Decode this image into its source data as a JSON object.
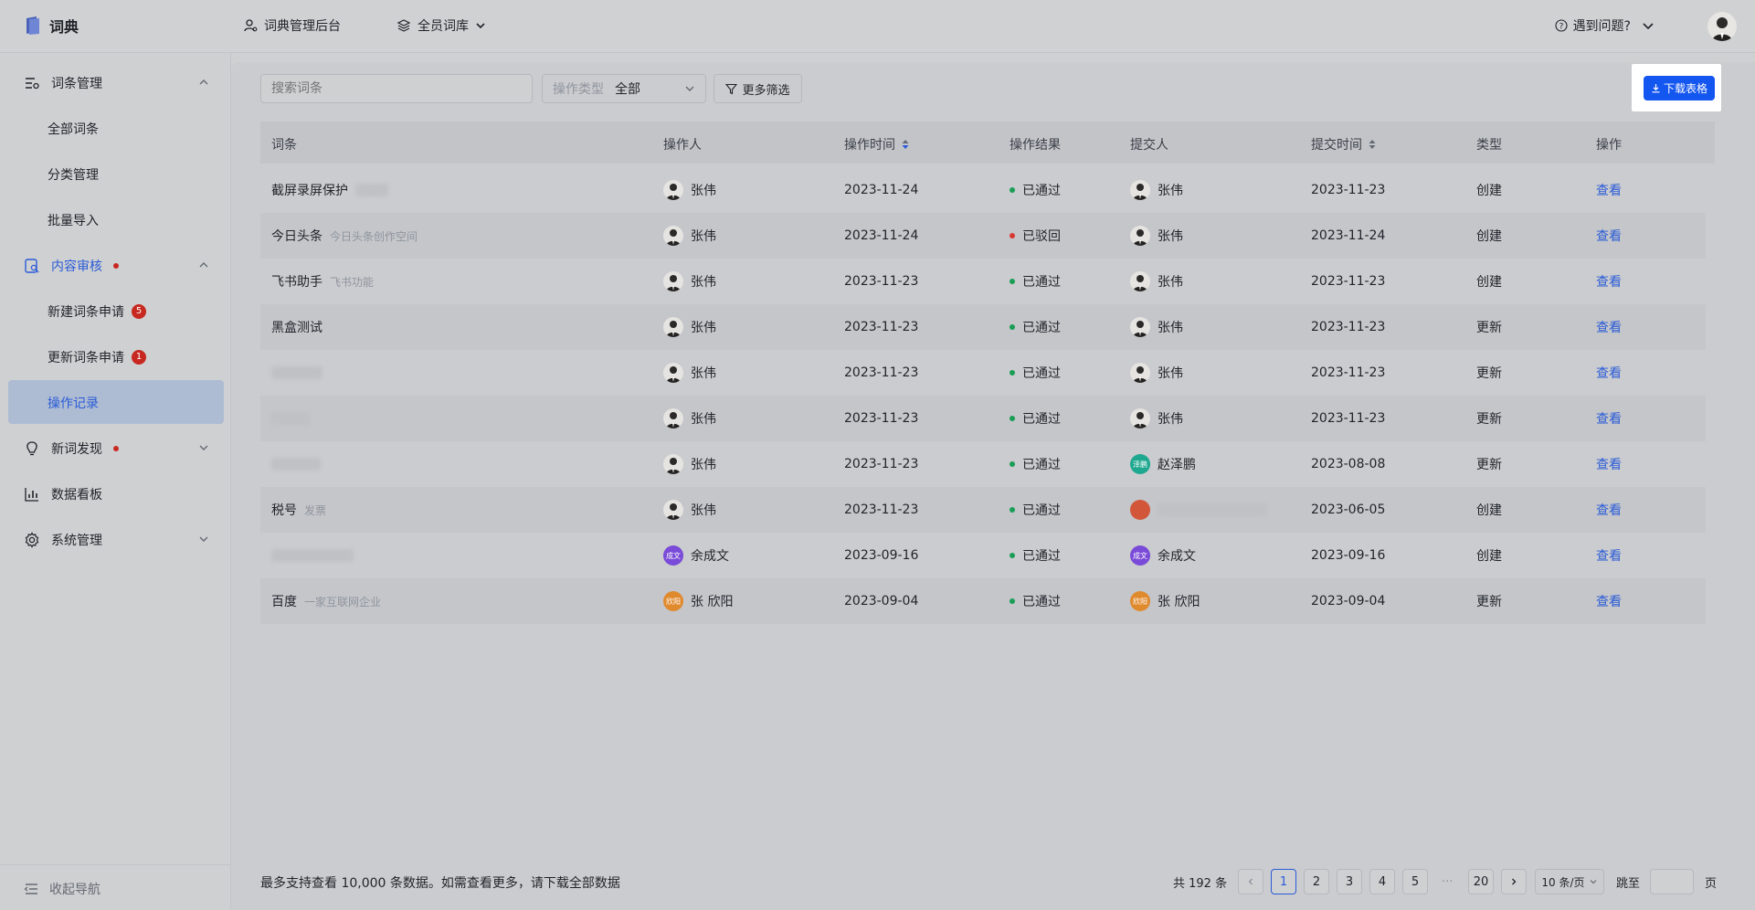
{
  "header": {
    "app_title": "词典",
    "admin_label": "词典管理后台",
    "library_label": "全员词库",
    "help_label": "遇到问题?"
  },
  "sidebar": {
    "groups": [
      {
        "label": "词条管理",
        "icon": "list-settings-icon"
      },
      {
        "label": "内容审核",
        "icon": "review-doc-icon"
      },
      {
        "label": "新词发现",
        "icon": "lightbulb-icon"
      },
      {
        "label": "数据看板",
        "icon": "bar-chart-icon"
      },
      {
        "label": "系统管理",
        "icon": "gear-icon"
      }
    ],
    "entry_items": [
      "全部词条",
      "分类管理",
      "批量导入"
    ],
    "review_items": [
      {
        "label": "新建词条申请",
        "badge": "5"
      },
      {
        "label": "更新词条申请",
        "badge": "1"
      },
      {
        "label": "操作记录"
      }
    ],
    "collapse_label": "收起导航"
  },
  "toolbar": {
    "search_placeholder": "搜索词条",
    "op_type_label": "操作类型",
    "op_type_value": "全部",
    "more_filter_label": "更多筛选",
    "download_label": "下载表格"
  },
  "table": {
    "columns": [
      "词条",
      "操作人",
      "操作时间",
      "操作结果",
      "提交人",
      "提交时间",
      "类型",
      "操作"
    ],
    "rows": [
      {
        "term": "截屏录屏保护",
        "desc": "",
        "operator": "张伟",
        "op_time": "2023-11-24",
        "result": "已通过",
        "submitter": "张伟",
        "submit_time": "2023-11-23",
        "type": "创建",
        "action": "查看"
      },
      {
        "term": "今日头条",
        "desc": "今日头条创作空间",
        "operator": "张伟",
        "op_time": "2023-11-24",
        "result": "已驳回",
        "submitter": "张伟",
        "submit_time": "2023-11-24",
        "type": "创建",
        "action": "查看"
      },
      {
        "term": "飞书助手",
        "desc": "飞书功能",
        "operator": "张伟",
        "op_time": "2023-11-23",
        "result": "已通过",
        "submitter": "张伟",
        "submit_time": "2023-11-23",
        "type": "创建",
        "action": "查看"
      },
      {
        "term": "黑盒测试",
        "desc": "",
        "operator": "张伟",
        "op_time": "2023-11-23",
        "result": "已通过",
        "submitter": "张伟",
        "submit_time": "2023-11-23",
        "type": "更新",
        "action": "查看"
      },
      {
        "term": "",
        "desc": "",
        "operator": "张伟",
        "op_time": "2023-11-23",
        "result": "已通过",
        "submitter": "张伟",
        "submit_time": "2023-11-23",
        "type": "更新",
        "action": "查看"
      },
      {
        "term": "",
        "desc": "",
        "operator": "张伟",
        "op_time": "2023-11-23",
        "result": "已通过",
        "submitter": "张伟",
        "submit_time": "2023-11-23",
        "type": "更新",
        "action": "查看"
      },
      {
        "term": "",
        "desc": "",
        "operator": "张伟",
        "op_time": "2023-11-23",
        "result": "已通过",
        "submitter": "赵泽鹏",
        "submitter_avatar": "泽鹏",
        "submit_time": "2023-08-08",
        "type": "更新",
        "action": "查看"
      },
      {
        "term": "税号",
        "desc": "发票",
        "operator": "张伟",
        "op_time": "2023-11-23",
        "result": "已通过",
        "submitter": "",
        "submit_time": "2023-06-05",
        "type": "创建",
        "action": "查看"
      },
      {
        "term": "",
        "desc": "",
        "operator": "余成文",
        "operator_avatar": "成文",
        "op_time": "2023-09-16",
        "result": "已通过",
        "submitter": "余成文",
        "submitter_avatar": "成文",
        "submit_time": "2023-09-16",
        "type": "创建",
        "action": "查看"
      },
      {
        "term": "百度",
        "desc": "一家互联网企业",
        "operator": "张 欣阳",
        "operator_avatar": "欣阳",
        "op_time": "2023-09-04",
        "result": "已通过",
        "submitter": "张 欣阳",
        "submitter_avatar": "欣阳",
        "submit_time": "2023-09-04",
        "type": "更新",
        "action": "查看"
      }
    ]
  },
  "footer": {
    "note": "最多支持查看 10,000 条数据。如需查看更多，请下载全部数据",
    "total": "共 192 条",
    "pages": [
      "1",
      "2",
      "3",
      "4",
      "5"
    ],
    "ellipsis": "···",
    "last_page": "20",
    "page_size": "10 条/页",
    "jump_label": "跳至",
    "page_unit": "页"
  },
  "colors": {
    "accent": "#2a5bd7",
    "download_button": "#1456f0",
    "approved": "#1a9d55",
    "rejected": "#d83931",
    "badge": "#c7281f"
  }
}
